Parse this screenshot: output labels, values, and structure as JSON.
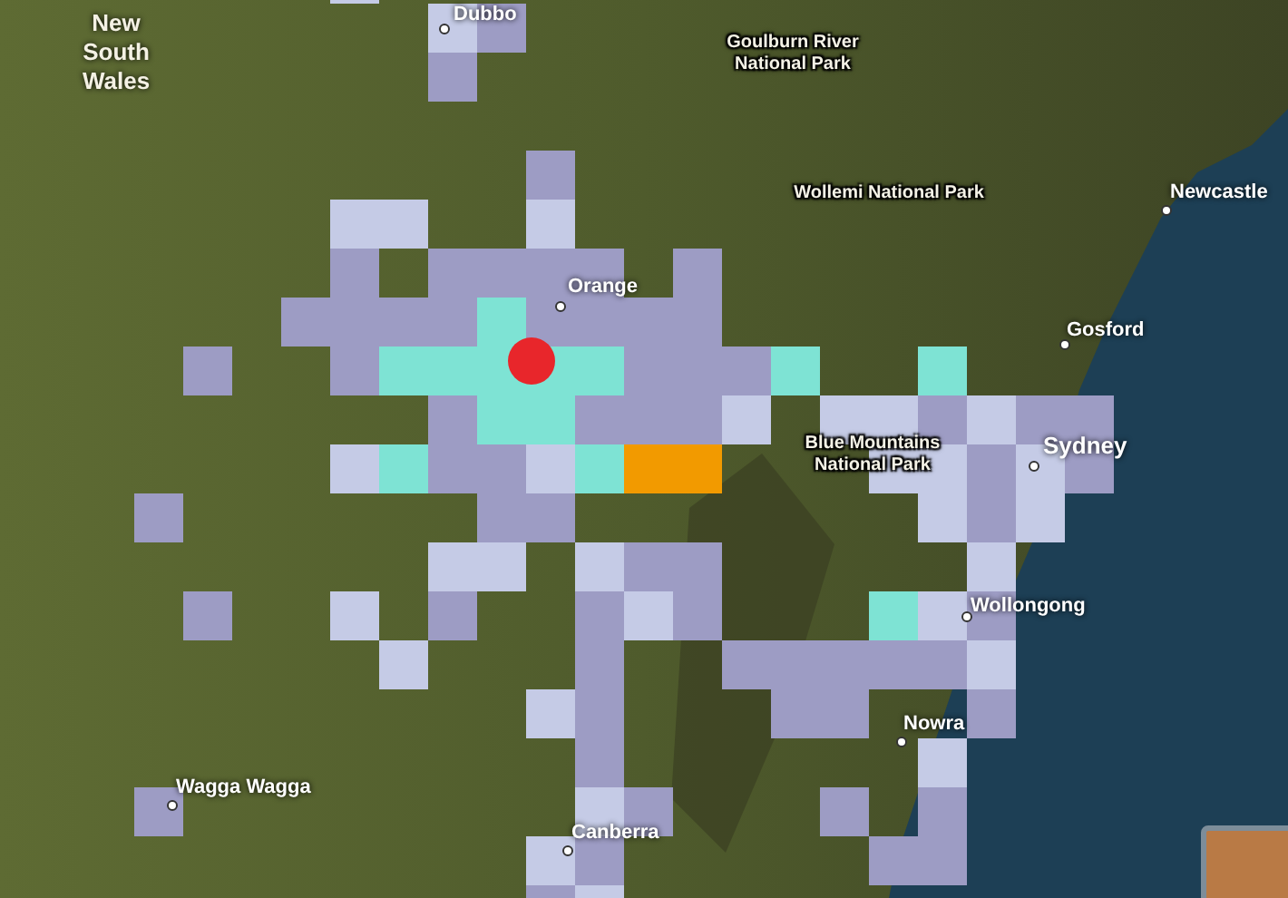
{
  "labels": [
    {
      "text": "New South Wales",
      "kind": "region"
    },
    {
      "text": "Dubbo",
      "kind": "city"
    },
    {
      "text": "Goulburn River National Park",
      "kind": "park"
    },
    {
      "text": "Wollemi National Park",
      "kind": "park"
    },
    {
      "text": "Newcastle",
      "kind": "city"
    },
    {
      "text": "Orange",
      "kind": "city"
    },
    {
      "text": "Gosford",
      "kind": "city"
    },
    {
      "text": "Blue Mountains National Park",
      "kind": "park"
    },
    {
      "text": "Sydney",
      "kind": "bigcity"
    },
    {
      "text": "Wollongong",
      "kind": "city"
    },
    {
      "text": "Nowra",
      "kind": "city"
    },
    {
      "text": "Wagga Wagga",
      "kind": "city"
    },
    {
      "text": "Canberra",
      "kind": "city"
    }
  ],
  "cells": [
    {
      "color": "#c5cbe6"
    },
    {
      "color": "#c5cbe6"
    },
    {
      "color": "#9d9cc4"
    },
    {
      "color": "#9d9cc4"
    },
    {
      "color": "#9d9cc4"
    },
    {
      "color": "#c5cbe6"
    },
    {
      "color": "#c5cbe6"
    },
    {
      "color": "#c5cbe6"
    },
    {
      "color": "#9d9cc4"
    },
    {
      "color": "#9d9cc4"
    },
    {
      "color": "#9d9cc4"
    },
    {
      "color": "#9d9cc4"
    },
    {
      "color": "#9d9cc4"
    },
    {
      "color": "#9d9cc4"
    },
    {
      "color": "#9d9cc4"
    },
    {
      "color": "#9d9cc4"
    },
    {
      "color": "#9d9cc4"
    },
    {
      "color": "#9d9cc4"
    },
    {
      "color": "#7ee3d4"
    },
    {
      "color": "#9d9cc4"
    },
    {
      "color": "#9d9cc4"
    },
    {
      "color": "#9d9cc4"
    },
    {
      "color": "#9d9cc4"
    },
    {
      "color": "#9d9cc4"
    },
    {
      "color": "#9d9cc4"
    },
    {
      "color": "#7ee3d4"
    },
    {
      "color": "#7ee3d4"
    },
    {
      "color": "#7ee3d4"
    },
    {
      "color": "#7ee3d4"
    },
    {
      "color": "#7ee3d4"
    },
    {
      "color": "#9d9cc4"
    },
    {
      "color": "#9d9cc4"
    },
    {
      "color": "#9d9cc4"
    },
    {
      "color": "#7ee3d4"
    },
    {
      "color": "#7ee3d4"
    },
    {
      "color": "#9d9cc4"
    },
    {
      "color": "#7ee3d4"
    },
    {
      "color": "#7ee3d4"
    },
    {
      "color": "#9d9cc4"
    },
    {
      "color": "#9d9cc4"
    },
    {
      "color": "#9d9cc4"
    },
    {
      "color": "#c5cbe6"
    },
    {
      "color": "#c5cbe6"
    },
    {
      "color": "#c5cbe6"
    },
    {
      "color": "#9d9cc4"
    },
    {
      "color": "#c5cbe6"
    },
    {
      "color": "#9d9cc4"
    },
    {
      "color": "#9d9cc4"
    },
    {
      "color": "#c5cbe6"
    },
    {
      "color": "#7ee3d4"
    },
    {
      "color": "#9d9cc4"
    },
    {
      "color": "#9d9cc4"
    },
    {
      "color": "#c5cbe6"
    },
    {
      "color": "#7ee3d4"
    },
    {
      "color": "#f29a00"
    },
    {
      "color": "#f29a00"
    },
    {
      "color": "#c5cbe6"
    },
    {
      "color": "#c5cbe6"
    },
    {
      "color": "#9d9cc4"
    },
    {
      "color": "#c5cbe6"
    },
    {
      "color": "#9d9cc4"
    },
    {
      "color": "#9d9cc4"
    },
    {
      "color": "#9d9cc4"
    },
    {
      "color": "#9d9cc4"
    },
    {
      "color": "#c5cbe6"
    },
    {
      "color": "#9d9cc4"
    },
    {
      "color": "#c5cbe6"
    },
    {
      "color": "#c5cbe6"
    },
    {
      "color": "#c5cbe6"
    },
    {
      "color": "#c5cbe6"
    },
    {
      "color": "#9d9cc4"
    },
    {
      "color": "#9d9cc4"
    },
    {
      "color": "#c5cbe6"
    },
    {
      "color": "#9d9cc4"
    },
    {
      "color": "#c5cbe6"
    },
    {
      "color": "#9d9cc4"
    },
    {
      "color": "#9d9cc4"
    },
    {
      "color": "#c5cbe6"
    },
    {
      "color": "#9d9cc4"
    },
    {
      "color": "#7ee3d4"
    },
    {
      "color": "#c5cbe6"
    },
    {
      "color": "#9d9cc4"
    },
    {
      "color": "#c5cbe6"
    },
    {
      "color": "#9d9cc4"
    },
    {
      "color": "#9d9cc4"
    },
    {
      "color": "#9d9cc4"
    },
    {
      "color": "#9d9cc4"
    },
    {
      "color": "#9d9cc4"
    },
    {
      "color": "#9d9cc4"
    },
    {
      "color": "#c5cbe6"
    },
    {
      "color": "#c5cbe6"
    },
    {
      "color": "#9d9cc4"
    },
    {
      "color": "#9d9cc4"
    },
    {
      "color": "#9d9cc4"
    },
    {
      "color": "#9d9cc4"
    },
    {
      "color": "#9d9cc4"
    },
    {
      "color": "#c5cbe6"
    },
    {
      "color": "#9d9cc4"
    },
    {
      "color": "#c5cbe6"
    },
    {
      "color": "#9d9cc4"
    },
    {
      "color": "#9d9cc4"
    },
    {
      "color": "#9d9cc4"
    },
    {
      "color": "#c5cbe6"
    },
    {
      "color": "#9d9cc4"
    },
    {
      "color": "#9d9cc4"
    },
    {
      "color": "#9d9cc4"
    },
    {
      "color": "#9d9cc4"
    },
    {
      "color": "#c5cbe6"
    }
  ]
}
